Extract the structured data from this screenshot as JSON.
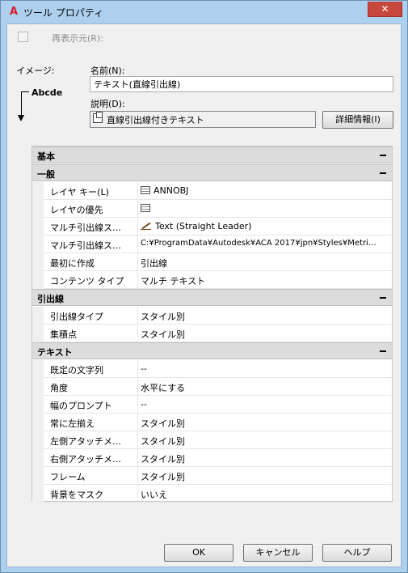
{
  "window": {
    "title": "ツール プロパティ",
    "app_icon": "A",
    "close_label": "✕"
  },
  "redisplay": {
    "label": "再表示元(R):",
    "checked": false
  },
  "preview": {
    "label": "イメージ:",
    "sample_text": "Abcde"
  },
  "name": {
    "label": "名前(N):",
    "value": "テキスト(直線引出線)"
  },
  "description": {
    "label": "説明(D):",
    "value": "直線引出線付きテキスト"
  },
  "details_button": "詳細情報(I)",
  "categories": [
    {
      "title": "基本"
    },
    {
      "title": "一般",
      "rows": [
        {
          "name": "レイヤ キー(L)",
          "value": "ANNOBJ",
          "icon": "table-icon"
        },
        {
          "name": "レイヤの優先",
          "value": "",
          "icon": "table-icon"
        },
        {
          "name": "マルチ引出線ス…",
          "value": "Text (Straight Leader)",
          "icon": "leader-icon"
        },
        {
          "name": "マルチ引出線ス…",
          "value": "C:¥ProgramData¥Autodesk¥ACA  2017¥jpn¥Styles¥Metri…"
        },
        {
          "name": "最初に作成",
          "value": "引出線"
        },
        {
          "name": "コンテンツ タイプ",
          "value": "マルチ テキスト"
        }
      ]
    },
    {
      "title": "引出線",
      "rows": [
        {
          "name": "引出線タイプ",
          "value": "スタイル別"
        },
        {
          "name": "集積点",
          "value": "スタイル別"
        }
      ]
    },
    {
      "title": "テキスト",
      "rows": [
        {
          "name": "既定の文字列",
          "value": "--"
        },
        {
          "name": "角度",
          "value": "水平にする"
        },
        {
          "name": "幅のプロンプト",
          "value": "--"
        },
        {
          "name": "常に左揃え",
          "value": "スタイル別"
        },
        {
          "name": "左側アタッチメ…",
          "value": "スタイル別"
        },
        {
          "name": "右側アタッチメ…",
          "value": "スタイル別"
        },
        {
          "name": "フレーム",
          "value": "スタイル別"
        },
        {
          "name": "背景をマスク",
          "value": "いいえ"
        }
      ]
    }
  ],
  "buttons": {
    "ok": "OK",
    "cancel": "キャンセル",
    "help": "ヘルプ"
  }
}
